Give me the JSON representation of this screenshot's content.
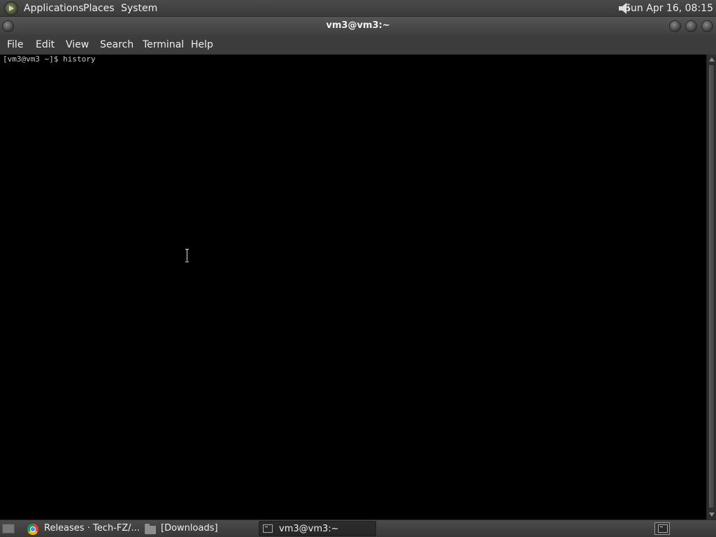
{
  "top_panel": {
    "menus": [
      "Applications",
      "Places",
      "System"
    ],
    "clock": "Sun Apr 16, 08:15"
  },
  "window": {
    "title": "vm3@vm3:~"
  },
  "menu_bar": {
    "items": [
      "File",
      "Edit",
      "View",
      "Search",
      "Terminal",
      "Help"
    ]
  },
  "terminal": {
    "prompt": "[vm3@vm3 ~]$ history"
  },
  "taskbar": {
    "items": [
      {
        "label": "Releases · Tech-FZ/...",
        "icon": "chrome-icon"
      },
      {
        "label": "[Downloads]",
        "icon": "folder-icon"
      },
      {
        "label": "vm3@vm3:~",
        "icon": "terminal-icon"
      }
    ]
  }
}
